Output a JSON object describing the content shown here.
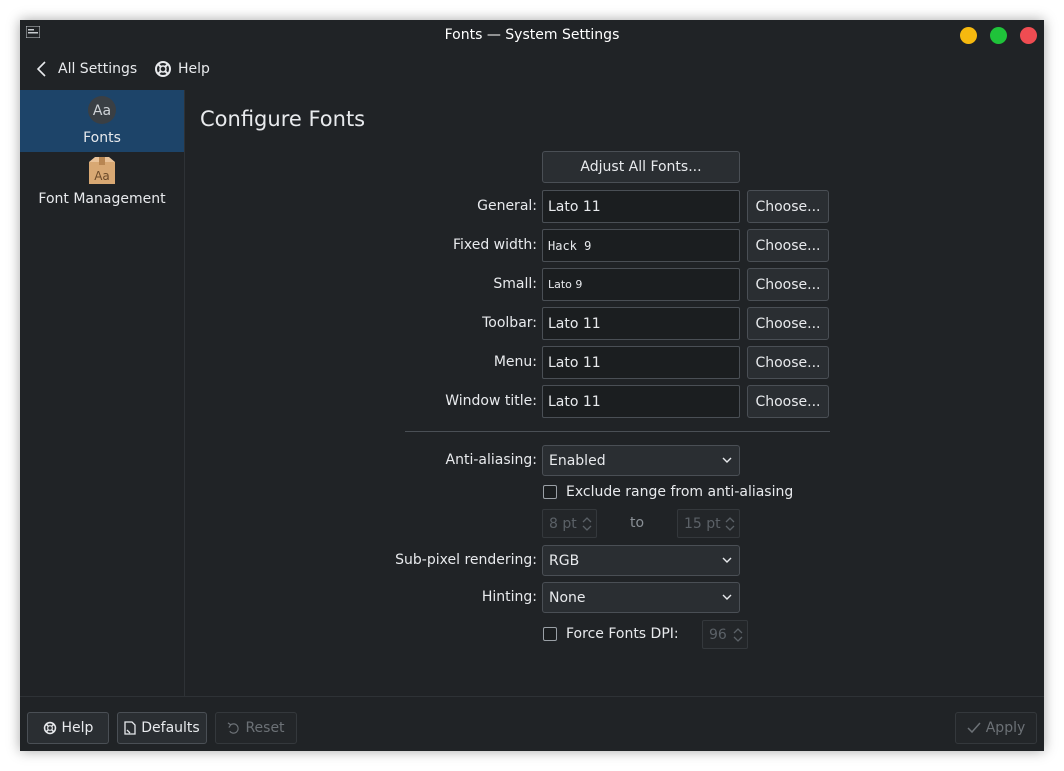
{
  "window": {
    "title": "Fonts — System Settings",
    "controls": {
      "minimize_color": "#f6b90f",
      "maximize_color": "#1fc33a",
      "close_color": "#f04c52"
    }
  },
  "toolbar": {
    "back_label": "All Settings",
    "help_label": "Help"
  },
  "sidebar": {
    "items": [
      {
        "label": "Fonts",
        "icon": "fonts-aa-icon",
        "active": true
      },
      {
        "label": "Font Management",
        "icon": "font-package-icon",
        "active": false
      }
    ],
    "icon_glyph": "Aa"
  },
  "main": {
    "title": "Configure Fonts",
    "adjust_all_label": "Adjust All Fonts...",
    "choose_label": "Choose...",
    "fonts": [
      {
        "label": "General:",
        "value": "Lato 11"
      },
      {
        "label": "Fixed width:",
        "value": "Hack 9"
      },
      {
        "label": "Small:",
        "value": "Lato 9"
      },
      {
        "label": "Toolbar:",
        "value": "Lato 11"
      },
      {
        "label": "Menu:",
        "value": "Lato 11"
      },
      {
        "label": "Window title:",
        "value": "Lato 11"
      }
    ],
    "antialiasing": {
      "label": "Anti-aliasing:",
      "value": "Enabled",
      "exclude_label": "Exclude range from anti-aliasing",
      "exclude_checked": false,
      "range_from": "8 pt",
      "range_to_label": "to",
      "range_to": "15 pt"
    },
    "subpixel": {
      "label": "Sub-pixel rendering:",
      "value": "RGB"
    },
    "hinting": {
      "label": "Hinting:",
      "value": "None"
    },
    "force_dpi": {
      "label": "Force Fonts DPI:",
      "checked": false,
      "value": "96"
    }
  },
  "footer": {
    "help_label": "Help",
    "defaults_label": "Defaults",
    "reset_label": "Reset",
    "apply_label": "Apply"
  },
  "colors": {
    "accent": "#1d4469",
    "window_bg": "#202326",
    "field_bg": "#1b1e20"
  }
}
